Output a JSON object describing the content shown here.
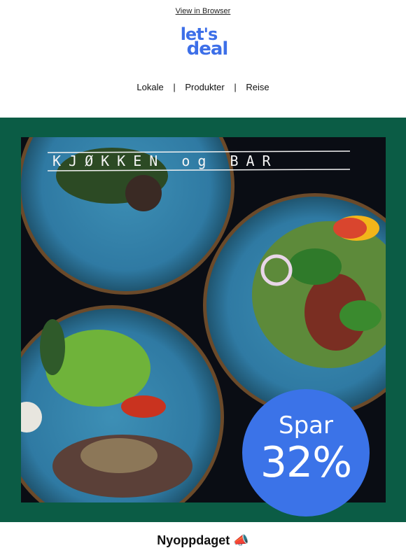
{
  "header": {
    "view_in_browser": "View in Browser"
  },
  "logo": {
    "line1": "let's",
    "line2": "deal",
    "color": "#3d6fe8"
  },
  "nav": {
    "items": [
      "Lokale",
      "Produkter",
      "Reise"
    ],
    "separator": "|"
  },
  "hero": {
    "background": "#0b5c45",
    "restaurant_banner": "KJØKKEN og BAR",
    "badge": {
      "label": "Spar",
      "value": "32%",
      "color": "#3b73e8"
    }
  },
  "section": {
    "heading": "Nyoppdaget 📣"
  }
}
